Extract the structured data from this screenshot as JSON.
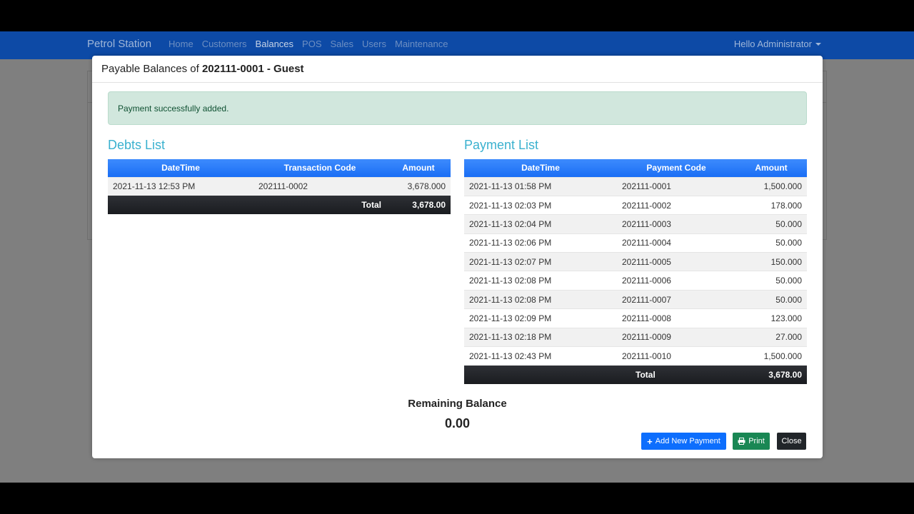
{
  "navbar": {
    "brand": "Petrol Station",
    "links": [
      {
        "label": "Home",
        "active": false
      },
      {
        "label": "Customers",
        "active": false
      },
      {
        "label": "Balances",
        "active": true
      },
      {
        "label": "POS",
        "active": false
      },
      {
        "label": "Sales",
        "active": false
      },
      {
        "label": "Users",
        "active": false
      },
      {
        "label": "Maintenance",
        "active": false
      }
    ],
    "user_label": "Hello Administrator"
  },
  "modal": {
    "title_prefix": "Payable Balances of",
    "title_subject": "202111-0001 - Guest",
    "alert_text": "Payment successfully added.",
    "debts": {
      "title": "Debts List",
      "columns": [
        "DateTime",
        "Transaction Code",
        "Amount"
      ],
      "rows": [
        {
          "datetime": "2021-11-13 12:53 PM",
          "code": "202111-0002",
          "amount": "3,678.000"
        }
      ],
      "total_label": "Total",
      "total_value": "3,678.00"
    },
    "payments": {
      "title": "Payment List",
      "columns": [
        "DateTime",
        "Payment Code",
        "Amount"
      ],
      "rows": [
        {
          "datetime": "2021-11-13 01:58 PM",
          "code": "202111-0001",
          "amount": "1,500.000"
        },
        {
          "datetime": "2021-11-13 02:03 PM",
          "code": "202111-0002",
          "amount": "178.000"
        },
        {
          "datetime": "2021-11-13 02:04 PM",
          "code": "202111-0003",
          "amount": "50.000"
        },
        {
          "datetime": "2021-11-13 02:06 PM",
          "code": "202111-0004",
          "amount": "50.000"
        },
        {
          "datetime": "2021-11-13 02:07 PM",
          "code": "202111-0005",
          "amount": "150.000"
        },
        {
          "datetime": "2021-11-13 02:08 PM",
          "code": "202111-0006",
          "amount": "50.000"
        },
        {
          "datetime": "2021-11-13 02:08 PM",
          "code": "202111-0007",
          "amount": "50.000"
        },
        {
          "datetime": "2021-11-13 02:09 PM",
          "code": "202111-0008",
          "amount": "123.000"
        },
        {
          "datetime": "2021-11-13 02:18 PM",
          "code": "202111-0009",
          "amount": "27.000"
        },
        {
          "datetime": "2021-11-13 02:43 PM",
          "code": "202111-0010",
          "amount": "1,500.000"
        }
      ],
      "total_label": "Total",
      "total_value": "3,678.00"
    },
    "remaining_label": "Remaining Balance",
    "remaining_value": "0.00",
    "buttons": {
      "add_payment": "Add New Payment",
      "print": "Print",
      "close": "Close"
    }
  },
  "colors": {
    "navbar": "#0d4aa6",
    "header_blue": "#0d6efd",
    "success": "#198754",
    "dark": "#212529",
    "title_cyan": "#3ab1cf"
  },
  "icons": [
    "plus-icon",
    "printer-icon",
    "caret-down-icon"
  ]
}
